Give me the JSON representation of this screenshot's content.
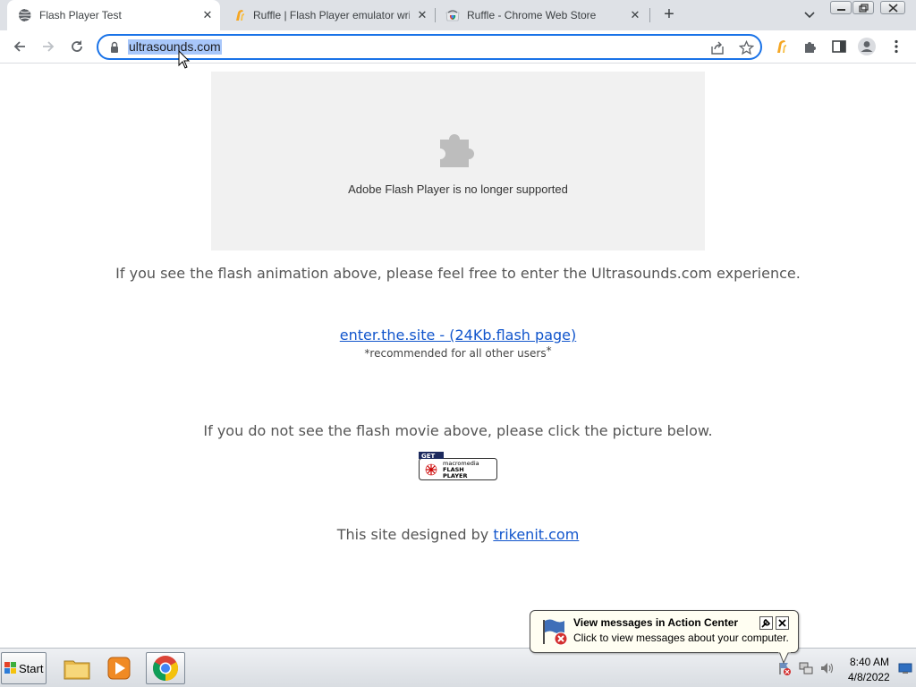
{
  "browser": {
    "tabs": [
      {
        "title": "Flash Player Test",
        "active": true,
        "favicon": "globe-icon"
      },
      {
        "title": "Ruffle | Flash Player emulator writ",
        "active": false,
        "favicon": "ruffle-icon"
      },
      {
        "title": "Ruffle - Chrome Web Store",
        "active": false,
        "favicon": "chrome-web-store-icon"
      }
    ],
    "new_tab": "+",
    "address": "ultrasounds.com",
    "accent": "#1a73e8"
  },
  "page": {
    "plugin_message": "Adobe Flash Player is no longer supported",
    "intro_text": "If you see the flash animation above, please feel free to enter the Ultrasounds.com experience.",
    "enter_link": "enter.the.site - (24Kb.flash page)",
    "recommended": "*recommended for all other users",
    "recommended_mark": "*",
    "no_flash_text": "If you do not see the flash movie above, please click the picture below.",
    "get_flash": {
      "get": "GET",
      "line1": "macromedia",
      "line2": "FLASH",
      "line3": "PLAYER"
    },
    "designed_by": "This site designed by ",
    "designer_link": "trikenit.com",
    "link_color": "#1155cc"
  },
  "balloon": {
    "title": "View messages in Action Center",
    "text": "Click to view messages about your computer."
  },
  "taskbar": {
    "start_label": "Start",
    "time": "8:40 AM",
    "date": "4/8/2022"
  }
}
